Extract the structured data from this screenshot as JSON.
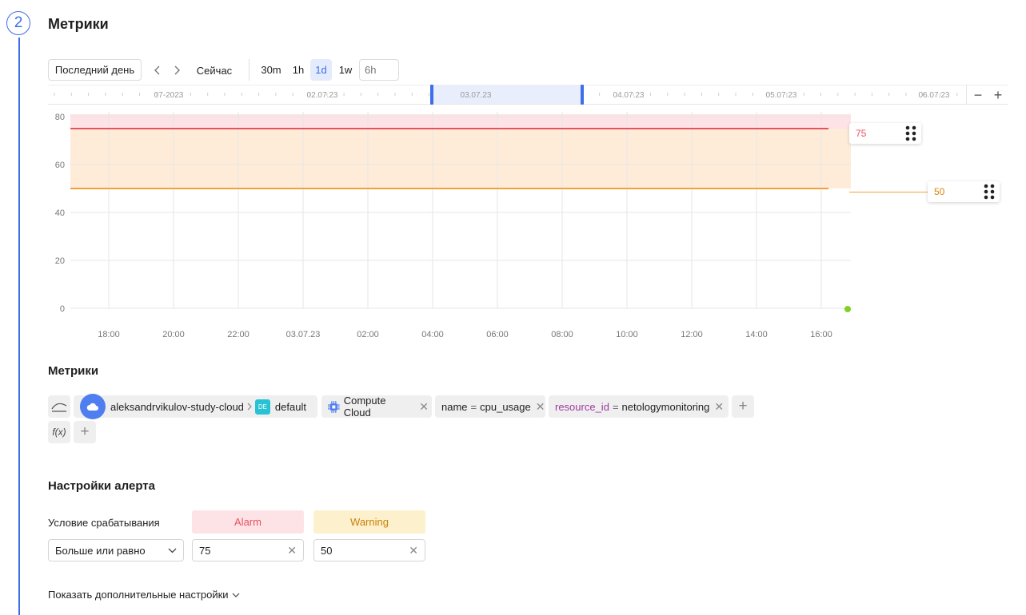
{
  "step": {
    "number": "2"
  },
  "section_title": "Метрики",
  "toolbar": {
    "period_label": "Последний день",
    "now_label": "Сейчас",
    "scales": [
      "30m",
      "1h",
      "1d",
      "1w"
    ],
    "active_scale": "1d",
    "custom_placeholder": "6h"
  },
  "timeline": {
    "labels": [
      "07-2023",
      "02.07.23",
      "03.07.23",
      "04.07.23",
      "05.07.23",
      "06.07.23"
    ],
    "zoom_out": "−",
    "zoom_in": "+"
  },
  "chart_data": {
    "type": "line",
    "y_ticks": [
      "80",
      "60",
      "40",
      "20",
      "0"
    ],
    "x_ticks": [
      "18:00",
      "20:00",
      "22:00",
      "03.07.23",
      "02:00",
      "04:00",
      "06:00",
      "08:00",
      "10:00",
      "12:00",
      "14:00",
      "16:00"
    ],
    "ylim": [
      0,
      82
    ],
    "series": [
      {
        "values": [
          0
        ]
      }
    ],
    "thresholds": {
      "alarm": {
        "value": 75,
        "label": "75",
        "color": "#e8525f",
        "fill": "#fde3e5"
      },
      "warning": {
        "value": 50,
        "label": "50",
        "color": "#f2a13a",
        "fill": "#feecd9"
      }
    },
    "point_color": "#7ed321"
  },
  "metrics": {
    "title": "Метрики",
    "cloud": "aleksandrvikulov-study-cloud",
    "folder_badge": "DE",
    "folder": "default",
    "service": "Compute Cloud",
    "name_key": "name",
    "eq": "=",
    "name_value": "cpu_usage",
    "resource_key": "resource_id",
    "resource_value": "netologymonitoring",
    "func_label": "f(x)",
    "add": "+"
  },
  "alert": {
    "title": "Настройки алерта",
    "condition_label": "Условие срабатывания",
    "alarm_label": "Alarm",
    "warning_label": "Warning",
    "operator": "Больше или равно",
    "alarm_value": "75",
    "warning_value": "50",
    "more_settings": "Показать дополнительные настройки"
  }
}
